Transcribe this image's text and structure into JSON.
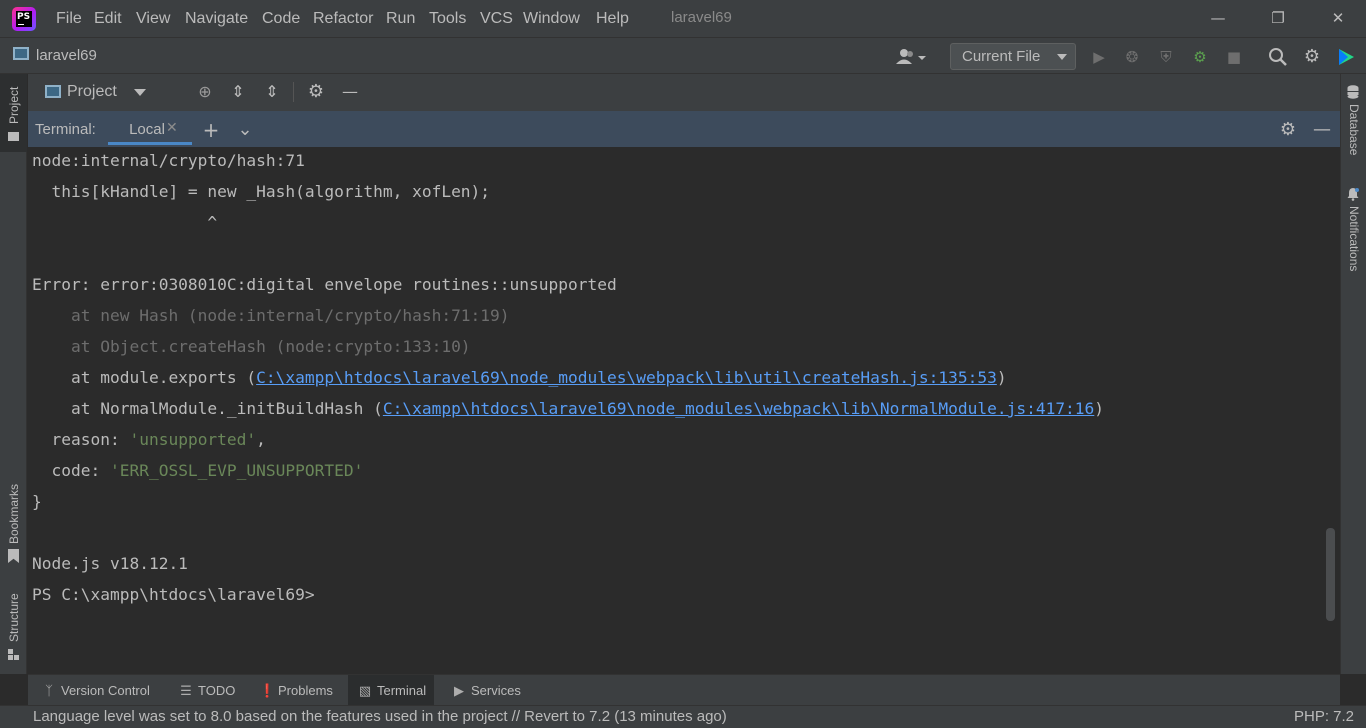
{
  "menubar": {
    "items": [
      "File",
      "Edit",
      "View",
      "Navigate",
      "Code",
      "Refactor",
      "Run",
      "Tools",
      "VCS",
      "Window",
      "Help"
    ],
    "window_title": "laravel69",
    "logo_text": "PS"
  },
  "navbar": {
    "project_name": "laravel69",
    "run_config": "Current File"
  },
  "left_stripe": {
    "project": "Project",
    "bookmarks": "Bookmarks",
    "structure": "Structure"
  },
  "right_stripe": {
    "database": "Database",
    "notifications": "Notifications"
  },
  "project_panel": {
    "label": "Project"
  },
  "terminal": {
    "title": "Terminal:",
    "tab": "Local",
    "lines": [
      "node:internal/crypto/hash:71",
      "  this[kHandle] = new _Hash(algorithm, xofLen);",
      "                  ^",
      "",
      "Error: error:0308010C:digital envelope routines::unsupported",
      "    at new Hash (node:internal/crypto/hash:71:19)",
      "    at Object.createHash (node:crypto:133:10)",
      "    at module.exports (",
      "C:\\xampp\\htdocs\\laravel69\\node_modules\\webpack\\lib\\util\\createHash.js:135:53",
      ")",
      "    at NormalModule._initBuildHash (",
      "C:\\xampp\\htdocs\\laravel69\\node_modules\\webpack\\lib\\NormalModule.js:417:16",
      ")",
      "  reason: ",
      "'unsupported'",
      ",",
      "  code: ",
      "'ERR_OSSL_EVP_UNSUPPORTED'",
      "}",
      "",
      "Node.js v18.12.1",
      "PS C:\\xampp\\htdocs\\laravel69>"
    ]
  },
  "bottom_tabs": [
    "Version Control",
    "TODO",
    "Problems",
    "Terminal",
    "Services"
  ],
  "statusbar": {
    "message": "Language level was set to 8.0 based on the features used in the project // Revert to 7.2 (13 minutes ago)",
    "php": "PHP: 7.2"
  },
  "colors": {
    "background": "#2b2b2b",
    "panel": "#3c3f41",
    "terminal_header": "#3d4b5c",
    "link": "#589df6",
    "string": "#6a8759",
    "accent": "#4a88c7"
  }
}
